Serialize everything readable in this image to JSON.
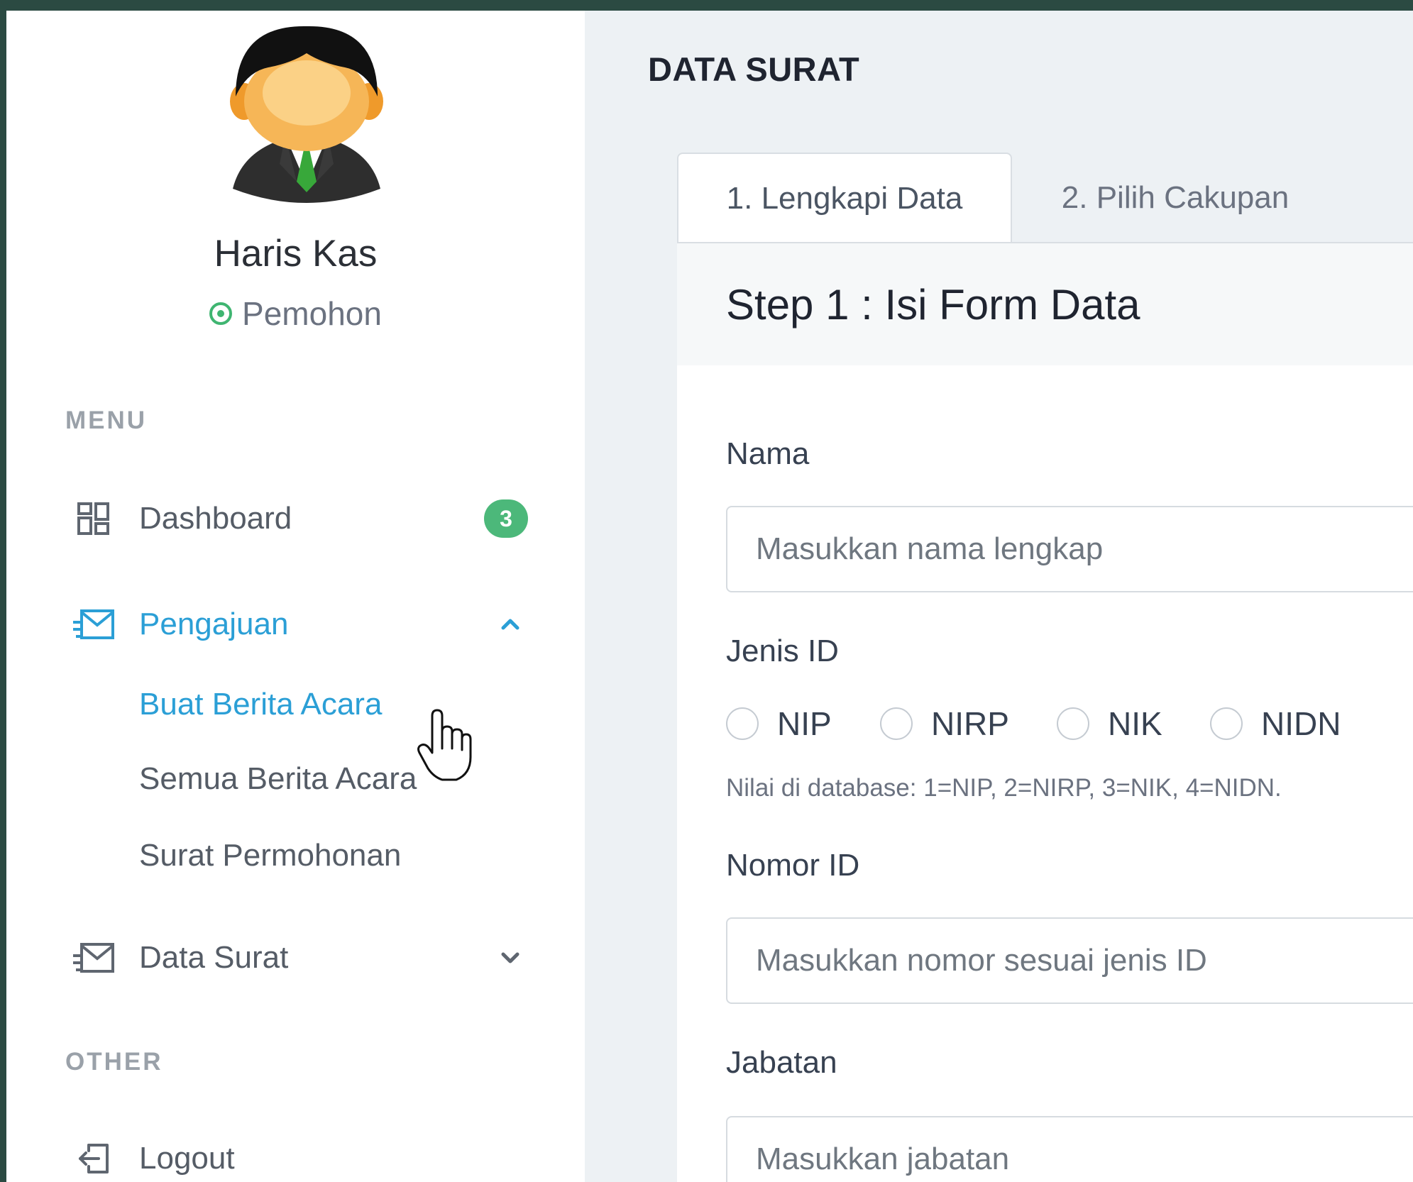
{
  "sidebar": {
    "user_name": "Haris Kas",
    "user_role": "Pemohon",
    "menu_label": "MENU",
    "other_label": "OTHER",
    "dashboard": {
      "label": "Dashboard",
      "badge": "3"
    },
    "pengajuan": {
      "label": "Pengajuan"
    },
    "sub_items": [
      "Buat Berita Acara",
      "Semua Berita Acara",
      "Surat Permohonan"
    ],
    "data_surat": {
      "label": "Data Surat"
    },
    "logout": {
      "label": "Logout"
    }
  },
  "main": {
    "page_title": "DATA SURAT",
    "tabs": [
      "1. Lengkapi Data",
      "2. Pilih Cakupan"
    ],
    "step_title": "Step 1 : Isi Form Data",
    "form": {
      "nama_label": "Nama",
      "nama_placeholder": "Masukkan nama lengkap",
      "jenis_id_label": "Jenis ID",
      "jenis_id_options": [
        "NIP",
        "NIRP",
        "NIK",
        "NIDN"
      ],
      "jenis_id_helper": "Nilai di database: 1=NIP, 2=NIRP, 3=NIK, 4=NIDN.",
      "nomor_id_label": "Nomor ID",
      "nomor_id_placeholder": "Masukkan nomor sesuai jenis ID",
      "jabatan_label": "Jabatan",
      "jabatan_placeholder": "Masukkan jabatan"
    }
  },
  "colors": {
    "accent": "#2b9fd6",
    "badge": "#4cb87a",
    "status": "#3fb571",
    "frame": "#2b4a42"
  }
}
